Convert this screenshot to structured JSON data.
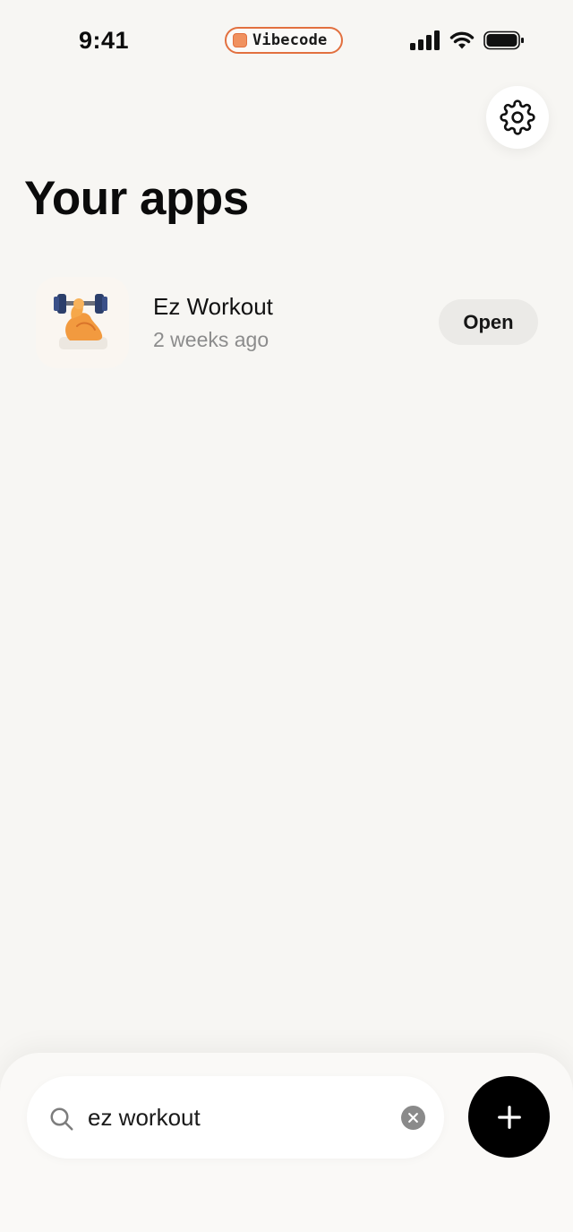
{
  "status_bar": {
    "time": "9:41",
    "app_pill_label": "Vibecode",
    "pill_accent": "#e2703f",
    "icons": [
      "cellular-signal-icon",
      "wifi-icon",
      "battery-icon"
    ]
  },
  "header": {
    "settings_icon": "gear-icon",
    "title": "Your apps"
  },
  "apps": [
    {
      "name": "Ez Workout",
      "updated": "2 weeks ago",
      "icon": "flexed-biceps-dumbbell-icon",
      "action_label": "Open"
    }
  ],
  "search": {
    "value": "ez workout",
    "placeholder": "",
    "search_icon": "search-icon",
    "clear_icon": "clear-icon"
  },
  "add_button": {
    "icon": "plus-icon"
  }
}
